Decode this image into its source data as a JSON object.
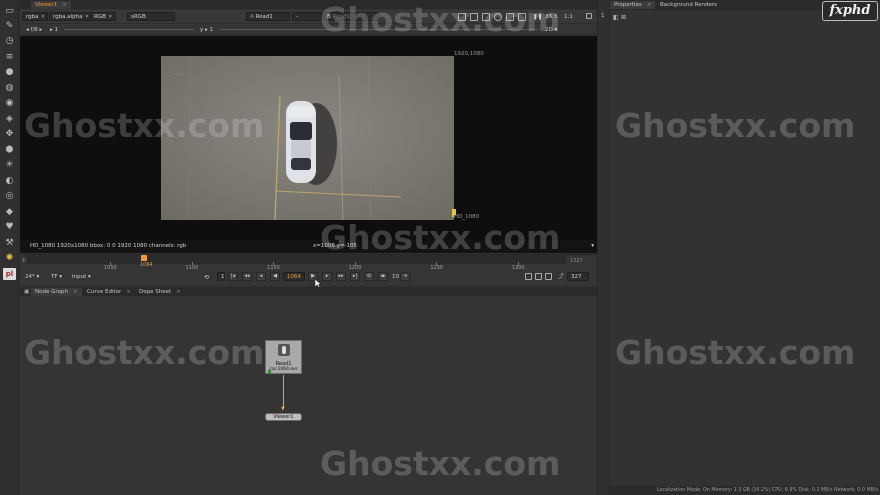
{
  "viewer": {
    "tab_label": "Viewer1",
    "channels": "rgba",
    "alpha": "rgba.alpha",
    "colorspace": "RGB",
    "lut": "sRGB",
    "input_a": "Read1",
    "input_a_mode": "-",
    "input_b_label": "B",
    "input_b": "Read1",
    "zoom": "33.3",
    "proxy": "1:1",
    "fstop": "f/8",
    "gain": "1",
    "gamma_label": "y",
    "gamma": "1",
    "view_mode": "2D",
    "format_top": "1920,1080",
    "format_bottom": "HD_1080",
    "info_left": "HD_1080 1920x1080   bbox: 0 0 1920 1080 channels: rgb",
    "info_coords": "x=1008 y=-105"
  },
  "timeline": {
    "start": "1001",
    "end": "1327",
    "current_frame": "1064",
    "ticks": [
      "1001",
      "1050",
      "1100",
      "1150",
      "1200",
      "1250",
      "1300",
      "1327"
    ],
    "fps": "24*",
    "tf": "TF",
    "mode": "Input",
    "increment": "10",
    "frame_field": "1064",
    "out_field": "327",
    "in_field": "1"
  },
  "graph": {
    "tabs": [
      "Node Graph",
      "Curve Editor",
      "Dope Sheet"
    ],
    "read_node_name": "Read1",
    "read_node_file": "car.1064.exr",
    "viewer_node_name": "Viewer1"
  },
  "properties": {
    "tabs": [
      "Properties",
      "Background Renders"
    ],
    "max_panels": "1",
    "status": "Localization Mode: On  Memory: 1.3 GB (16.2%)  CPU: 6.9%  Disk: 0.2 MB/s  Network: 0.0 MB/s"
  },
  "branding": {
    "logo": "fxphd",
    "watermark": "Ghostxx.com"
  },
  "colors": {
    "accent": "#f09a34",
    "viewer_bg": "#0e0e0e",
    "panel_bg": "#323232"
  }
}
